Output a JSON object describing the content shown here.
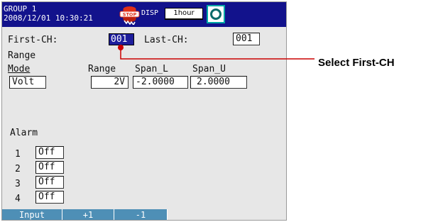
{
  "status_bar": {
    "group": "GROUP 1",
    "datetime": "2008/12/01 10:30:21",
    "stop_badge": "STOP",
    "disp_label": "DISP",
    "trend_interval": "1hour",
    "colors": {
      "background": "#12128c",
      "stop_icon": "#e03018",
      "display_icon": "#00a6a6"
    }
  },
  "channel": {
    "first_label": "First-CH:",
    "first_value": "001",
    "last_label": "Last-CH:",
    "last_value": "001"
  },
  "range": {
    "section_label": "Range",
    "mode_label": "Mode",
    "range_label": "Range",
    "span_l_label": "Span_L",
    "span_u_label": "Span_U",
    "mode_value": "Volt",
    "range_value": "2V",
    "span_l_value": "-2.0000",
    "span_u_value": "2.0000"
  },
  "alarm": {
    "section_label": "Alarm",
    "rows": [
      {
        "num": "1",
        "value": "Off"
      },
      {
        "num": "2",
        "value": "Off"
      },
      {
        "num": "3",
        "value": "Off"
      },
      {
        "num": "4",
        "value": "Off"
      }
    ]
  },
  "softkeys": [
    "Input",
    "+1",
    "-1"
  ],
  "callout": {
    "label": "Select First-CH",
    "color": "#cc0000"
  }
}
